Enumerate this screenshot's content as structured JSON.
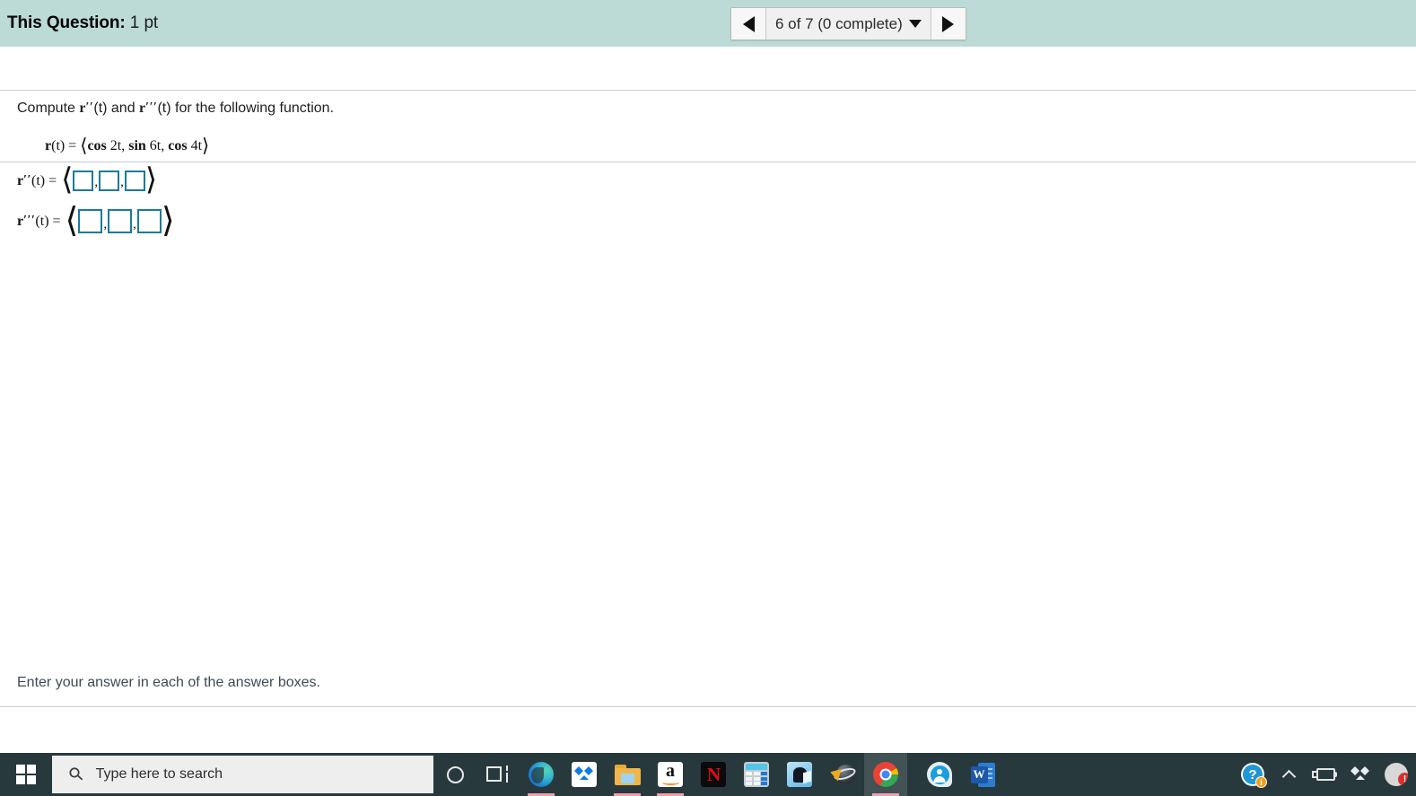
{
  "header": {
    "question_label": "This Question:",
    "question_points": "1 pt",
    "nav": {
      "prev_icon": "triangle-left-icon",
      "next_icon": "triangle-right-icon",
      "selector_text": "6 of 7 (0 complete)",
      "caret_icon": "caret-down-icon"
    }
  },
  "problem": {
    "prompt_pre": "Compute ",
    "prompt_r1": "r",
    "prompt_primes1": "′′",
    "prompt_mid": "(t) and ",
    "prompt_r2": "r",
    "prompt_primes2": "′′′",
    "prompt_post": "(t) for the following function.",
    "function_label": "r",
    "function_eq": "(t) = ",
    "function_open": "⟨",
    "function_body_1_bold": "cos",
    "function_body_1_rest": " 2t",
    "function_sep_1": ", ",
    "function_body_2_bold": "sin",
    "function_body_2_rest": " 6t",
    "function_sep_2": ", ",
    "function_body_3_bold": "cos",
    "function_body_3_rest": " 4t",
    "function_close": "⟩"
  },
  "answers": {
    "open_bracket": "⟨",
    "close_bracket": "⟩",
    "comma": ",",
    "box_border_color": "#1b7a9c",
    "rows": [
      {
        "label_var": "r",
        "label_primes": "′′",
        "label_eq": "(t) =",
        "values": [
          "",
          "",
          ""
        ],
        "placeholders": [
          "",
          "",
          ""
        ]
      },
      {
        "label_var": "r",
        "label_primes": "′′′",
        "label_eq": "(t) =",
        "values": [
          "",
          "",
          ""
        ],
        "placeholders": [
          "",
          "",
          ""
        ]
      }
    ]
  },
  "footnote": {
    "text": "Enter your answer in each of the answer boxes."
  },
  "taskbar": {
    "start_icon": "windows-start-icon",
    "search": {
      "icon": "search-icon",
      "placeholder": "Type here to search",
      "value": ""
    },
    "apps": [
      {
        "name": "cortana-icon",
        "label": "Cortana",
        "running": false,
        "active": false
      },
      {
        "name": "task-view-icon",
        "label": "Task View",
        "running": false,
        "active": false
      },
      {
        "name": "microsoft-edge-icon",
        "label": "Microsoft Edge",
        "running": true,
        "active": false
      },
      {
        "name": "dropbox-icon",
        "label": "Dropbox",
        "running": false,
        "active": false
      },
      {
        "name": "file-explorer-icon",
        "label": "File Explorer",
        "running": true,
        "active": false
      },
      {
        "name": "amazon-icon",
        "label": "Amazon",
        "running": true,
        "active": false,
        "glyph": "a"
      },
      {
        "name": "netflix-icon",
        "label": "Netflix",
        "running": false,
        "active": false,
        "glyph": "N"
      },
      {
        "name": "calculator-icon",
        "label": "Calculator",
        "running": false,
        "active": false
      },
      {
        "name": "kindle-icon",
        "label": "Kindle",
        "running": false,
        "active": false
      },
      {
        "name": "internet-explorer-icon",
        "label": "Internet Explorer",
        "running": false,
        "active": false
      },
      {
        "name": "google-chrome-icon",
        "label": "Google Chrome",
        "running": true,
        "active": true
      },
      {
        "name": "people-icon",
        "label": "People",
        "running": false,
        "active": false
      },
      {
        "name": "microsoft-word-icon",
        "label": "Microsoft Word",
        "running": false,
        "active": false,
        "glyph": "W"
      }
    ],
    "tray": [
      {
        "name": "help-icon",
        "label": "Help",
        "glyph": "?",
        "badge": "i"
      },
      {
        "name": "show-hidden-icons-chevron",
        "label": "Show hidden icons"
      },
      {
        "name": "battery-charging-icon",
        "label": "Battery charging"
      },
      {
        "name": "dropbox-tray-icon",
        "label": "Dropbox"
      },
      {
        "name": "edge-update-icon",
        "label": "Update available",
        "badge": "!"
      }
    ]
  },
  "colors": {
    "header_bg": "#bcdbd7",
    "taskbar_bg": "#27393c",
    "rule": "#c9cdd6",
    "input_border": "#1b7a9c",
    "running_indicator": "#f0a0b0"
  }
}
